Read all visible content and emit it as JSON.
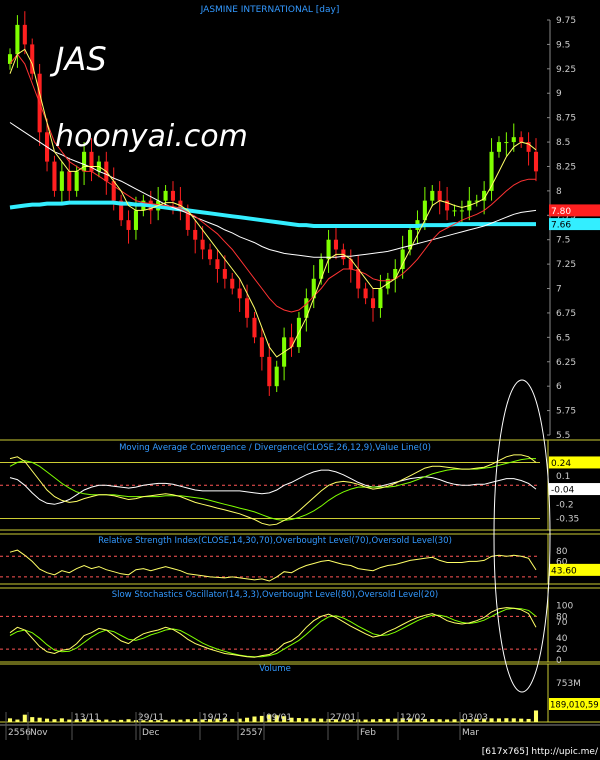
{
  "title": "JASMINE INTERNATIONAL [day]",
  "overlay_symbol": "JAS",
  "overlay_site": "hoonyai.com",
  "credit": "[617x765] http://upic.me/",
  "colors": {
    "up": "#7fff00",
    "down": "#ff2020",
    "ma_short": "#ffff66",
    "ma_mid": "#ff3333",
    "ma_long": "#ffffff",
    "ma_200": "#33eeff",
    "frame": "#cccc33",
    "grid": "#444444",
    "dash": "#ff5555",
    "title": "#3399ff"
  },
  "chart_data": [
    {
      "type": "candlestick",
      "title": "JASMINE INTERNATIONAL [day]",
      "ylim": [
        5.5,
        9.75
      ],
      "y_ticks": [
        "9.75",
        "9.5",
        "9.25",
        "9",
        "8.75",
        "8.5",
        "8.25",
        "8",
        "7.75",
        "7.5",
        "7.25",
        "7",
        "6.75",
        "6.5",
        "6.25",
        "6",
        "5.75",
        "5.5"
      ],
      "x_labels": [
        "2556",
        "Nov",
        "13/11",
        "29/11",
        "Dec",
        "19/12",
        "09/01",
        "2557",
        "27/01",
        "Feb",
        "12/02",
        "03/03",
        "Mar"
      ],
      "last_labels": [
        {
          "text": "7.80",
          "color": "#ff2020"
        },
        {
          "text": "7.66",
          "color": "#33eeff"
        }
      ],
      "close": [
        9.4,
        9.7,
        9.5,
        9.2,
        8.6,
        8.3,
        8.0,
        8.2,
        8.0,
        8.2,
        8.4,
        8.2,
        8.3,
        8.1,
        7.9,
        7.7,
        7.6,
        7.8,
        7.9,
        7.8,
        7.9,
        8.0,
        7.9,
        7.8,
        7.6,
        7.5,
        7.4,
        7.3,
        7.2,
        7.1,
        7.0,
        6.9,
        6.7,
        6.5,
        6.3,
        6.0,
        6.2,
        6.5,
        6.4,
        6.7,
        6.9,
        7.1,
        7.3,
        7.5,
        7.4,
        7.3,
        7.2,
        7.0,
        6.9,
        6.8,
        7.0,
        7.1,
        7.2,
        7.4,
        7.6,
        7.7,
        7.9,
        8.0,
        7.9,
        7.8,
        7.8,
        7.8,
        7.9,
        7.9,
        8.0,
        8.4,
        8.5,
        8.5,
        8.55,
        8.5,
        8.4,
        8.2
      ],
      "ma_short": [
        9.2,
        9.4,
        9.45,
        9.3,
        9.0,
        8.7,
        8.4,
        8.3,
        8.2,
        8.2,
        8.25,
        8.25,
        8.25,
        8.2,
        8.1,
        8.0,
        7.85,
        7.8,
        7.8,
        7.82,
        7.85,
        7.88,
        7.88,
        7.85,
        7.8,
        7.7,
        7.6,
        7.5,
        7.4,
        7.3,
        7.2,
        7.1,
        6.95,
        6.8,
        6.6,
        6.4,
        6.3,
        6.35,
        6.4,
        6.55,
        6.7,
        6.9,
        7.1,
        7.3,
        7.35,
        7.35,
        7.3,
        7.2,
        7.1,
        7.0,
        7.0,
        7.05,
        7.1,
        7.25,
        7.4,
        7.55,
        7.7,
        7.85,
        7.9,
        7.88,
        7.85,
        7.83,
        7.85,
        7.88,
        7.92,
        8.05,
        8.2,
        8.35,
        8.45,
        8.5,
        8.48,
        8.42
      ],
      "ma_mid": [
        9.3,
        9.4,
        9.3,
        9.1,
        8.9,
        8.7,
        8.5,
        8.4,
        8.3,
        8.25,
        8.2,
        8.2,
        8.15,
        8.1,
        8.05,
        8.0,
        7.95,
        7.9,
        7.88,
        7.87,
        7.86,
        7.85,
        7.84,
        7.82,
        7.78,
        7.74,
        7.68,
        7.62,
        7.56,
        7.48,
        7.4,
        7.3,
        7.2,
        7.1,
        7.0,
        6.9,
        6.82,
        6.78,
        6.76,
        6.78,
        6.84,
        6.92,
        7.0,
        7.1,
        7.15,
        7.2,
        7.2,
        7.18,
        7.15,
        7.1,
        7.08,
        7.08,
        7.1,
        7.15,
        7.22,
        7.3,
        7.4,
        7.5,
        7.58,
        7.62,
        7.66,
        7.7,
        7.73,
        7.76,
        7.8,
        7.86,
        7.93,
        8.0,
        8.06,
        8.1,
        8.12,
        8.12
      ],
      "ma_long": [
        8.7,
        8.65,
        8.6,
        8.55,
        8.5,
        8.45,
        8.4,
        8.37,
        8.33,
        8.3,
        8.27,
        8.24,
        8.2,
        8.17,
        8.13,
        8.1,
        8.06,
        8.02,
        7.98,
        7.94,
        7.9,
        7.86,
        7.83,
        7.8,
        7.77,
        7.73,
        7.7,
        7.67,
        7.64,
        7.6,
        7.57,
        7.53,
        7.5,
        7.47,
        7.43,
        7.4,
        7.38,
        7.36,
        7.35,
        7.34,
        7.33,
        7.32,
        7.32,
        7.32,
        7.32,
        7.33,
        7.33,
        7.34,
        7.35,
        7.36,
        7.37,
        7.38,
        7.4,
        7.42,
        7.44,
        7.46,
        7.48,
        7.5,
        7.52,
        7.54,
        7.56,
        7.58,
        7.6,
        7.62,
        7.64,
        7.67,
        7.7,
        7.73,
        7.76,
        7.78,
        7.79,
        7.8
      ],
      "ma_200": [
        7.83,
        7.84,
        7.85,
        7.86,
        7.86,
        7.87,
        7.87,
        7.87,
        7.88,
        7.88,
        7.88,
        7.88,
        7.88,
        7.88,
        7.88,
        7.87,
        7.87,
        7.86,
        7.86,
        7.85,
        7.84,
        7.83,
        7.82,
        7.81,
        7.8,
        7.79,
        7.78,
        7.77,
        7.76,
        7.75,
        7.74,
        7.73,
        7.72,
        7.71,
        7.7,
        7.69,
        7.68,
        7.67,
        7.66,
        7.65,
        7.65,
        7.64,
        7.64,
        7.64,
        7.64,
        7.64,
        7.64,
        7.64,
        7.64,
        7.64,
        7.64,
        7.64,
        7.64,
        7.64,
        7.64,
        7.64,
        7.65,
        7.65,
        7.65,
        7.65,
        7.66,
        7.66,
        7.66,
        7.66,
        7.66,
        7.66,
        7.66,
        7.66,
        7.66,
        7.66,
        7.66,
        7.66
      ]
    },
    {
      "type": "line",
      "title": "Moving Average Convergence / Divergence(CLOSE,26,12,9),Value Line(0)",
      "ylim": [
        -0.45,
        0.35
      ],
      "y_ticks": [
        "0.24",
        "0.1",
        "-0.04",
        "-0.2",
        "-0.35"
      ],
      "last_labels": [
        {
          "text": "0.24",
          "color": "#ffff00"
        },
        {
          "text": "-0.04",
          "color": "#ffffff"
        }
      ],
      "macd": [
        0.28,
        0.3,
        0.25,
        0.15,
        0.05,
        -0.05,
        -0.12,
        -0.16,
        -0.18,
        -0.17,
        -0.14,
        -0.12,
        -0.1,
        -0.1,
        -0.11,
        -0.13,
        -0.15,
        -0.14,
        -0.12,
        -0.11,
        -0.1,
        -0.09,
        -0.1,
        -0.12,
        -0.15,
        -0.18,
        -0.2,
        -0.22,
        -0.24,
        -0.26,
        -0.28,
        -0.3,
        -0.33,
        -0.36,
        -0.4,
        -0.42,
        -0.41,
        -0.37,
        -0.33,
        -0.27,
        -0.2,
        -0.13,
        -0.06,
        0.0,
        0.03,
        0.04,
        0.03,
        0.01,
        -0.02,
        -0.04,
        -0.03,
        -0.01,
        0.02,
        0.06,
        0.1,
        0.14,
        0.18,
        0.2,
        0.2,
        0.19,
        0.18,
        0.17,
        0.17,
        0.18,
        0.19,
        0.22,
        0.26,
        0.3,
        0.32,
        0.32,
        0.3,
        0.24
      ],
      "signal": [
        0.2,
        0.24,
        0.26,
        0.24,
        0.2,
        0.14,
        0.08,
        0.02,
        -0.03,
        -0.07,
        -0.09,
        -0.1,
        -0.1,
        -0.1,
        -0.1,
        -0.11,
        -0.12,
        -0.12,
        -0.12,
        -0.12,
        -0.12,
        -0.11,
        -0.11,
        -0.11,
        -0.12,
        -0.13,
        -0.14,
        -0.16,
        -0.18,
        -0.2,
        -0.22,
        -0.24,
        -0.26,
        -0.28,
        -0.31,
        -0.34,
        -0.36,
        -0.37,
        -0.36,
        -0.34,
        -0.31,
        -0.27,
        -0.22,
        -0.16,
        -0.11,
        -0.07,
        -0.04,
        -0.02,
        -0.02,
        -0.02,
        -0.02,
        -0.02,
        -0.01,
        0.01,
        0.03,
        0.06,
        0.09,
        0.12,
        0.14,
        0.16,
        0.17,
        0.17,
        0.17,
        0.17,
        0.18,
        0.19,
        0.21,
        0.23,
        0.25,
        0.27,
        0.28,
        0.28
      ],
      "osc": [
        0.08,
        0.06,
        0.0,
        -0.08,
        -0.15,
        -0.19,
        -0.2,
        -0.18,
        -0.15,
        -0.1,
        -0.05,
        -0.02,
        0.0,
        0.0,
        -0.01,
        -0.02,
        -0.03,
        -0.02,
        0.0,
        0.01,
        0.02,
        0.02,
        0.01,
        -0.01,
        -0.03,
        -0.05,
        -0.06,
        -0.06,
        -0.06,
        -0.06,
        -0.06,
        -0.06,
        -0.07,
        -0.08,
        -0.09,
        -0.08,
        -0.05,
        0.0,
        0.03,
        0.07,
        0.11,
        0.14,
        0.16,
        0.16,
        0.14,
        0.11,
        0.07,
        0.03,
        0.0,
        -0.02,
        -0.01,
        0.01,
        0.03,
        0.05,
        0.07,
        0.08,
        0.09,
        0.08,
        0.06,
        0.03,
        0.01,
        0.0,
        0.0,
        0.01,
        0.01,
        0.03,
        0.05,
        0.07,
        0.07,
        0.05,
        0.02,
        -0.04
      ]
    },
    {
      "type": "line",
      "title": "Relative Strength Index(CLOSE,14,30,70),Overbought Level(70),Oversold Level(30)",
      "ylim": [
        20,
        90
      ],
      "y_ticks": [
        "80",
        "60",
        "40"
      ],
      "reference_lines": [
        70,
        30
      ],
      "last_labels": [
        {
          "text": "43.60",
          "color": "#ffff00"
        }
      ],
      "values": [
        78,
        82,
        72,
        60,
        45,
        38,
        34,
        42,
        38,
        46,
        52,
        46,
        50,
        44,
        40,
        36,
        34,
        44,
        46,
        42,
        46,
        50,
        46,
        42,
        36,
        34,
        32,
        30,
        29,
        28,
        30,
        28,
        26,
        24,
        26,
        22,
        30,
        40,
        38,
        46,
        52,
        56,
        60,
        62,
        58,
        54,
        52,
        46,
        44,
        42,
        48,
        52,
        54,
        58,
        62,
        64,
        66,
        68,
        62,
        58,
        58,
        58,
        60,
        60,
        62,
        70,
        72,
        70,
        72,
        70,
        66,
        43.6
      ]
    },
    {
      "type": "line",
      "title": "Slow Stochastics Oscillator(14,3,3),Overbought Level(80),Oversold Level(20)",
      "ylim": [
        0,
        110
      ],
      "y_ticks": [
        "100",
        "80",
        "70",
        "40",
        "20",
        "0"
      ],
      "reference_lines": [
        80,
        20
      ],
      "k": [
        50,
        60,
        55,
        40,
        25,
        15,
        12,
        18,
        20,
        30,
        45,
        50,
        58,
        55,
        45,
        35,
        30,
        40,
        48,
        52,
        55,
        60,
        56,
        48,
        38,
        30,
        25,
        20,
        16,
        12,
        10,
        8,
        6,
        5,
        8,
        10,
        18,
        30,
        35,
        45,
        60,
        72,
        80,
        84,
        78,
        70,
        62,
        55,
        48,
        42,
        45,
        52,
        58,
        65,
        72,
        78,
        82,
        85,
        80,
        72,
        68,
        66,
        68,
        72,
        78,
        88,
        94,
        96,
        95,
        92,
        85,
        60
      ],
      "d": [
        45,
        52,
        55,
        50,
        40,
        28,
        18,
        15,
        16,
        22,
        32,
        42,
        50,
        55,
        52,
        45,
        38,
        36,
        40,
        46,
        50,
        55,
        57,
        54,
        47,
        39,
        31,
        25,
        20,
        16,
        12,
        9,
        7,
        6,
        6,
        8,
        12,
        20,
        28,
        36,
        47,
        59,
        71,
        79,
        81,
        77,
        70,
        62,
        55,
        48,
        45,
        46,
        51,
        58,
        65,
        72,
        78,
        82,
        82,
        79,
        73,
        69,
        67,
        69,
        73,
        80,
        87,
        93,
        95,
        94,
        91,
        80
      ]
    },
    {
      "type": "bar",
      "title": "Volume",
      "y_ticks": [
        "753M",
        "189,010,59"
      ],
      "values_millions": [
        60,
        40,
        120,
        80,
        70,
        55,
        45,
        60,
        40,
        35,
        50,
        30,
        35,
        40,
        30,
        35,
        45,
        30,
        28,
        32,
        30,
        35,
        40,
        38,
        45,
        50,
        42,
        48,
        55,
        60,
        50,
        55,
        70,
        90,
        100,
        120,
        110,
        95,
        70,
        65,
        60,
        60,
        55,
        50,
        45,
        40,
        38,
        42,
        40,
        44,
        48,
        52,
        55,
        60,
        58,
        55,
        50,
        48,
        45,
        42,
        44,
        46,
        48,
        52,
        56,
        60,
        58,
        62,
        60,
        55,
        50,
        189
      ]
    }
  ]
}
